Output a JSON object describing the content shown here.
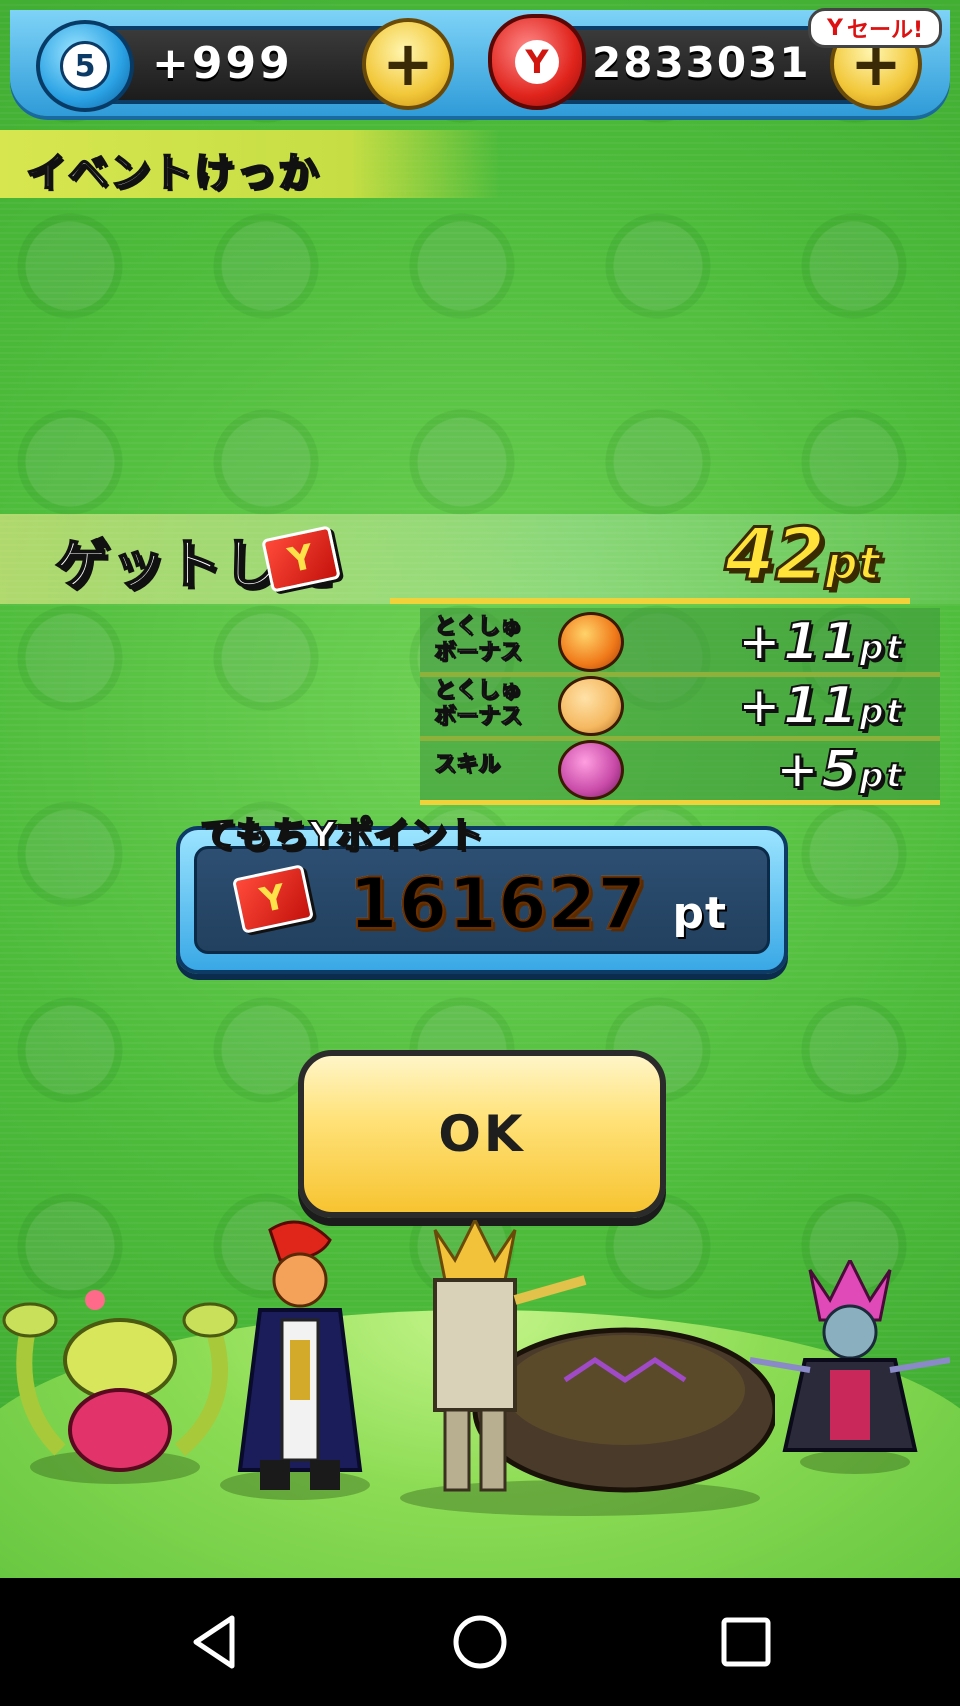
{
  "header": {
    "stamina_level": "5",
    "stamina_count": "+999",
    "money": "2833031",
    "sale_badge": "セール!",
    "sale_badge_icon": "Y"
  },
  "section": {
    "title": "イベントけっか"
  },
  "result": {
    "label": "ゲットした",
    "card_icon": "Y",
    "total_value": "42",
    "total_unit": "pt",
    "bonuses": [
      {
        "label_line1": "とくしゅ",
        "label_line2": "ボーナス",
        "value": "+11",
        "unit": "pt",
        "face_color": "#f07a1a"
      },
      {
        "label_line1": "とくしゅ",
        "label_line2": "ボーナス",
        "value": "+11",
        "unit": "pt",
        "face_color": "#f5b860"
      },
      {
        "label_line1": "スキル",
        "label_line2": "",
        "value": "+5",
        "unit": "pt",
        "face_color": "#c84aa8"
      }
    ]
  },
  "points": {
    "title": "てもちYポイント",
    "card_icon": "Y",
    "value": "161627",
    "unit": "pt"
  },
  "ok_button": {
    "label": "OK"
  },
  "colors": {
    "background_green": "#4cbb3a",
    "header_blue": "#2f9bd8",
    "gold": "#f2d23a",
    "ok_yellow": "#ffe27a"
  }
}
